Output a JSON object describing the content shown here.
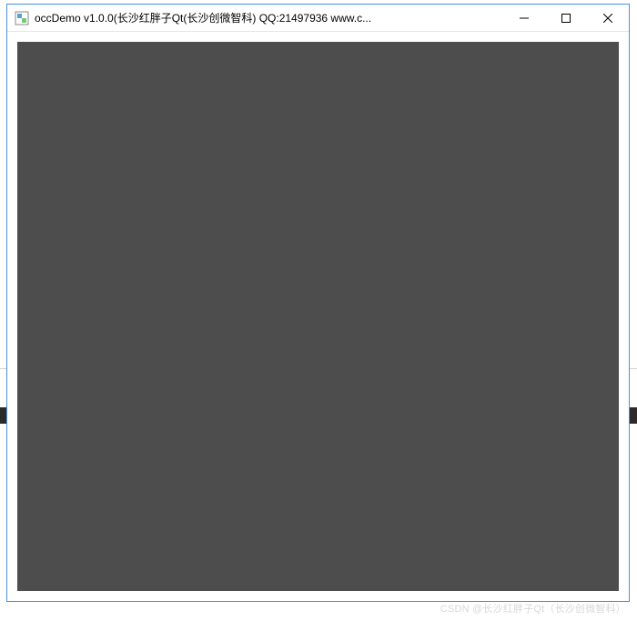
{
  "window": {
    "title": "occDemo v1.0.0(长沙红胖子Qt(长沙创微智科) QQ:21497936 www.c...",
    "controls": {
      "minimize": "minimize",
      "maximize": "maximize",
      "close": "close"
    }
  },
  "viewport": {
    "background_color": "#4d4d4d"
  },
  "watermark": "CSDN @长沙红胖子Qt（长沙创微智科）"
}
